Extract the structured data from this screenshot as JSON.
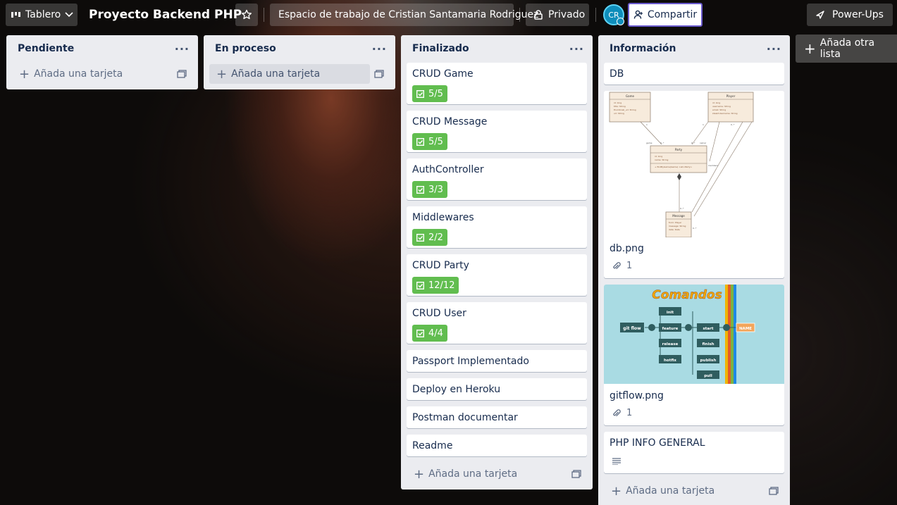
{
  "header": {
    "view_switcher": "Tablero",
    "board_title": "Proyecto Backend PHP",
    "workspace": "Espacio de trabajo de Cristian Santamaria Rodriguez",
    "visibility": "Privado",
    "avatar_initials": "CR",
    "share": "Compartir",
    "power_ups": "Power-Ups"
  },
  "lists": [
    {
      "title": "Pendiente",
      "add_card": "Añada una tarjeta"
    },
    {
      "title": "En proceso",
      "add_card": "Añada una tarjeta"
    },
    {
      "title": "Finalizado",
      "add_card": "Añada una tarjeta",
      "cards": [
        {
          "title": "CRUD Game",
          "checklist": "5/5"
        },
        {
          "title": "CRUD Message",
          "checklist": "5/5"
        },
        {
          "title": "AuthController",
          "checklist": "3/3"
        },
        {
          "title": "Middlewares",
          "checklist": "2/2"
        },
        {
          "title": "CRUD Party",
          "checklist": "12/12"
        },
        {
          "title": "CRUD User",
          "checklist": "4/4"
        },
        {
          "title": "Passport Implementado"
        },
        {
          "title": "Deploy en Heroku"
        },
        {
          "title": "Postman documentar"
        },
        {
          "title": "Readme"
        }
      ]
    },
    {
      "title": "Información",
      "add_card": "Añada una tarjeta",
      "cards": [
        {
          "title": "DB"
        },
        {
          "title": "db.png",
          "attachments": "1",
          "diagram": {
            "game": "Game",
            "player": "Player",
            "party": "Party",
            "message": "Message",
            "game_fields": [
              "id: long",
              "title: String",
              "thumbnail_url: String",
              "url: String"
            ],
            "player_fields": [
              "id: long",
              "username: String",
              "email: String",
              "steamUsername: String"
            ],
            "party_fields": [
              "id: long",
              "name: String"
            ],
            "party_method": "+ findByGame(Game): List<Party>",
            "message_fields": [
              "from: Player",
              "message: String",
              "date: Date"
            ],
            "rel_game": "game",
            "rel_owner": "owner",
            "rel_members": "members",
            "mult_one": "1",
            "mult_many": "0..*"
          }
        },
        {
          "title": "gitflow.png",
          "attachments": "1",
          "gitflow": {
            "heading": "Comandos",
            "cmd": "git flow",
            "init": "init",
            "feature": "feature",
            "release": "release",
            "hotfix": "hotfix",
            "start": "start",
            "finish": "finish",
            "publish": "publish",
            "pull": "pull",
            "name": "NAME"
          }
        },
        {
          "title": "PHP INFO GENERAL"
        }
      ]
    }
  ],
  "add_list": "Añada otra lista",
  "colors": {
    "badge_complete": "#61bd4f",
    "list_bg": "#ebecf0",
    "share_border": "#6a5acd"
  }
}
